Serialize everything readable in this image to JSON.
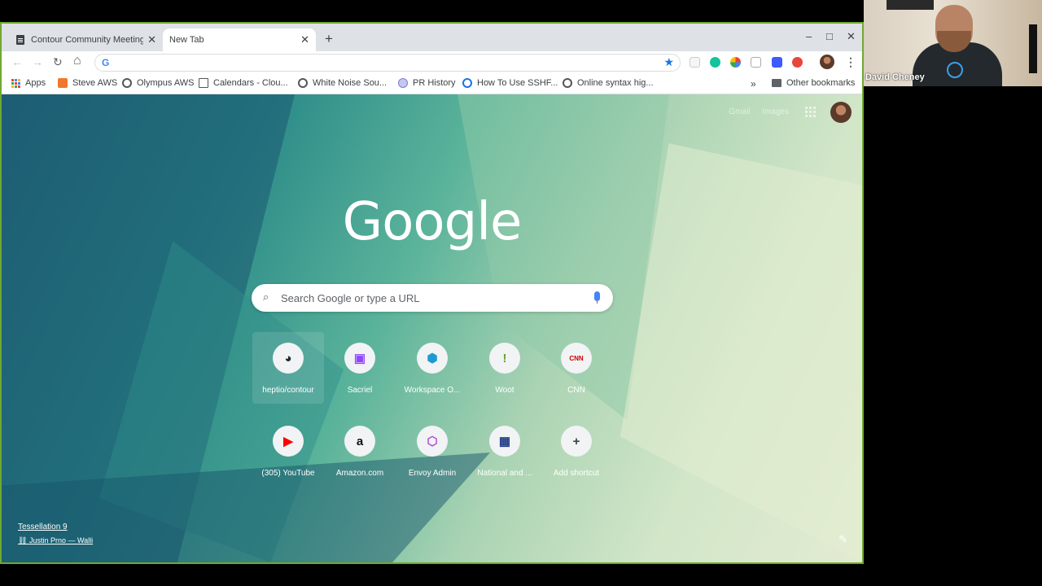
{
  "tabs": [
    {
      "title": "Contour Community Meeting",
      "active": false
    },
    {
      "title": "New Tab",
      "active": true
    }
  ],
  "window_controls": {
    "minimize": "–",
    "maximize": "□",
    "close": "✕"
  },
  "bookmarks": [
    {
      "label": "Apps",
      "icon": "apps-grid-icon"
    },
    {
      "label": "Steve AWS",
      "icon": "aws-cube-icon",
      "color": "#f0782b"
    },
    {
      "label": "Olympus AWS",
      "icon": "globe-icon",
      "color": "#555"
    },
    {
      "label": "Calendars - Clou...",
      "icon": "calendar-icon",
      "color": "#555"
    },
    {
      "label": "White Noise Sou...",
      "icon": "globe-icon",
      "color": "#555"
    },
    {
      "label": "PR History",
      "icon": "pr-history-icon",
      "color": "#7b7bd8"
    },
    {
      "label": "How To Use SSHF...",
      "icon": "ssh-icon",
      "color": "#1a73e8"
    },
    {
      "label": "Online syntax hig...",
      "icon": "globe-icon",
      "color": "#555"
    }
  ],
  "bookmarks_overflow": "»",
  "other_bookmarks": "Other bookmarks",
  "top_links": {
    "gmail": "Gmail",
    "images": "Images"
  },
  "logo": "Google",
  "search": {
    "placeholder": "Search Google or type a URL"
  },
  "shortcuts": [
    {
      "label": "heptio/contour",
      "icon": "github-icon",
      "glyph": "◕",
      "color": "#24292e",
      "hover": true
    },
    {
      "label": "Sacriel",
      "icon": "twitch-icon",
      "glyph": "▣",
      "color": "#9146ff"
    },
    {
      "label": "Workspace O...",
      "icon": "workspace-icon",
      "glyph": "⬢",
      "color": "#1d9bd1"
    },
    {
      "label": "Woot",
      "icon": "woot-icon",
      "glyph": "!",
      "color": "#6aa32d"
    },
    {
      "label": "CNN",
      "icon": "cnn-icon",
      "glyph": "CNN",
      "color": "#cc0000"
    },
    {
      "label": "(305) YouTube",
      "icon": "youtube-icon",
      "glyph": "▶",
      "color": "#ff0000"
    },
    {
      "label": "Amazon.com",
      "icon": "amazon-icon",
      "glyph": "a",
      "color": "#111"
    },
    {
      "label": "Envoy Admin",
      "icon": "envoy-icon",
      "glyph": "⬡",
      "color": "#b04bd6"
    },
    {
      "label": "National and ...",
      "icon": "weather-channel-icon",
      "glyph": "▦",
      "color": "#1f3c88"
    },
    {
      "label": "Add shortcut",
      "icon": "plus-icon",
      "glyph": "+",
      "color": "#3c4043"
    }
  ],
  "attribution": {
    "title": "Tessellation 9",
    "author": "Justin Prno — Walli"
  },
  "webcam": {
    "name": "David Cheney"
  }
}
